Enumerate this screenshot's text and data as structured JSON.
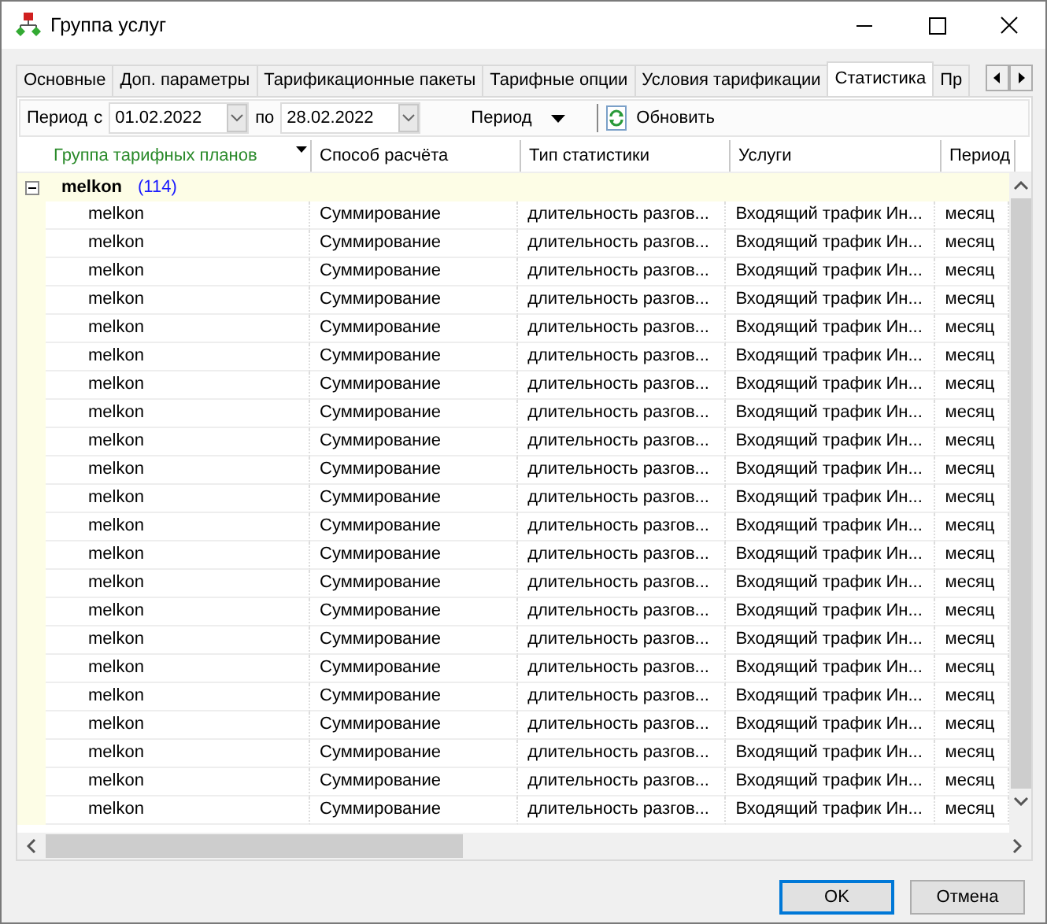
{
  "window": {
    "title": "Группа услуг"
  },
  "tabs": [
    {
      "label": "Основные",
      "selected": false
    },
    {
      "label": "Доп. параметры",
      "selected": false
    },
    {
      "label": "Тарификационные пакеты",
      "selected": false
    },
    {
      "label": "Тарифные опции",
      "selected": false
    },
    {
      "label": "Условия тарификации",
      "selected": false
    },
    {
      "label": "Статистика",
      "selected": true
    },
    {
      "label": "Пр",
      "selected": false
    }
  ],
  "toolbar": {
    "period_from_label": "Период",
    "from_label": "с",
    "from_value": "01.02.2022",
    "to_label": "по",
    "to_value": "28.02.2022",
    "period_dropdown": "Период",
    "refresh_button": "Обновить"
  },
  "table": {
    "columns": [
      {
        "label": "Группа тарифных планов",
        "sorted": true
      },
      {
        "label": "Способ расчёта",
        "sorted": false
      },
      {
        "label": "Тип статистики",
        "sorted": false
      },
      {
        "label": "Услуги",
        "sorted": false
      },
      {
        "label": "Период",
        "sorted": false
      }
    ],
    "group": {
      "name": "melkon",
      "count": "(114)",
      "expanded": true
    },
    "rows": [
      [
        "melkon",
        "Суммирование",
        "длительность разгов...",
        "Входящий трафик Ин...",
        "месяц"
      ],
      [
        "melkon",
        "Суммирование",
        "длительность разгов...",
        "Входящий трафик Ин...",
        "месяц"
      ],
      [
        "melkon",
        "Суммирование",
        "длительность разгов...",
        "Входящий трафик Ин...",
        "месяц"
      ],
      [
        "melkon",
        "Суммирование",
        "длительность разгов...",
        "Входящий трафик Ин...",
        "месяц"
      ],
      [
        "melkon",
        "Суммирование",
        "длительность разгов...",
        "Входящий трафик Ин...",
        "месяц"
      ],
      [
        "melkon",
        "Суммирование",
        "длительность разгов...",
        "Входящий трафик Ин...",
        "месяц"
      ],
      [
        "melkon",
        "Суммирование",
        "длительность разгов...",
        "Входящий трафик Ин...",
        "месяц"
      ],
      [
        "melkon",
        "Суммирование",
        "длительность разгов...",
        "Входящий трафик Ин...",
        "месяц"
      ],
      [
        "melkon",
        "Суммирование",
        "длительность разгов...",
        "Входящий трафик Ин...",
        "месяц"
      ],
      [
        "melkon",
        "Суммирование",
        "длительность разгов...",
        "Входящий трафик Ин...",
        "месяц"
      ],
      [
        "melkon",
        "Суммирование",
        "длительность разгов...",
        "Входящий трафик Ин...",
        "месяц"
      ],
      [
        "melkon",
        "Суммирование",
        "длительность разгов...",
        "Входящий трафик Ин...",
        "месяц"
      ],
      [
        "melkon",
        "Суммирование",
        "длительность разгов...",
        "Входящий трафик Ин...",
        "месяц"
      ],
      [
        "melkon",
        "Суммирование",
        "длительность разгов...",
        "Входящий трафик Ин...",
        "месяц"
      ],
      [
        "melkon",
        "Суммирование",
        "длительность разгов...",
        "Входящий трафик Ин...",
        "месяц"
      ],
      [
        "melkon",
        "Суммирование",
        "длительность разгов...",
        "Входящий трафик Ин...",
        "месяц"
      ],
      [
        "melkon",
        "Суммирование",
        "длительность разгов...",
        "Входящий трафик Ин...",
        "месяц"
      ],
      [
        "melkon",
        "Суммирование",
        "длительность разгов...",
        "Входящий трафик Ин...",
        "месяц"
      ],
      [
        "melkon",
        "Суммирование",
        "длительность разгов...",
        "Входящий трафик Ин...",
        "месяц"
      ],
      [
        "melkon",
        "Суммирование",
        "длительность разгов...",
        "Входящий трафик Ин...",
        "месяц"
      ],
      [
        "melkon",
        "Суммирование",
        "длительность разгов...",
        "Входящий трафик Ин...",
        "месяц"
      ],
      [
        "melkon",
        "Суммирование",
        "длительность разгов...",
        "Входящий трафик Ин...",
        "месяц"
      ]
    ]
  },
  "buttons": [
    {
      "label": "OK",
      "default": true
    },
    {
      "label": "Отмена",
      "default": false
    }
  ]
}
